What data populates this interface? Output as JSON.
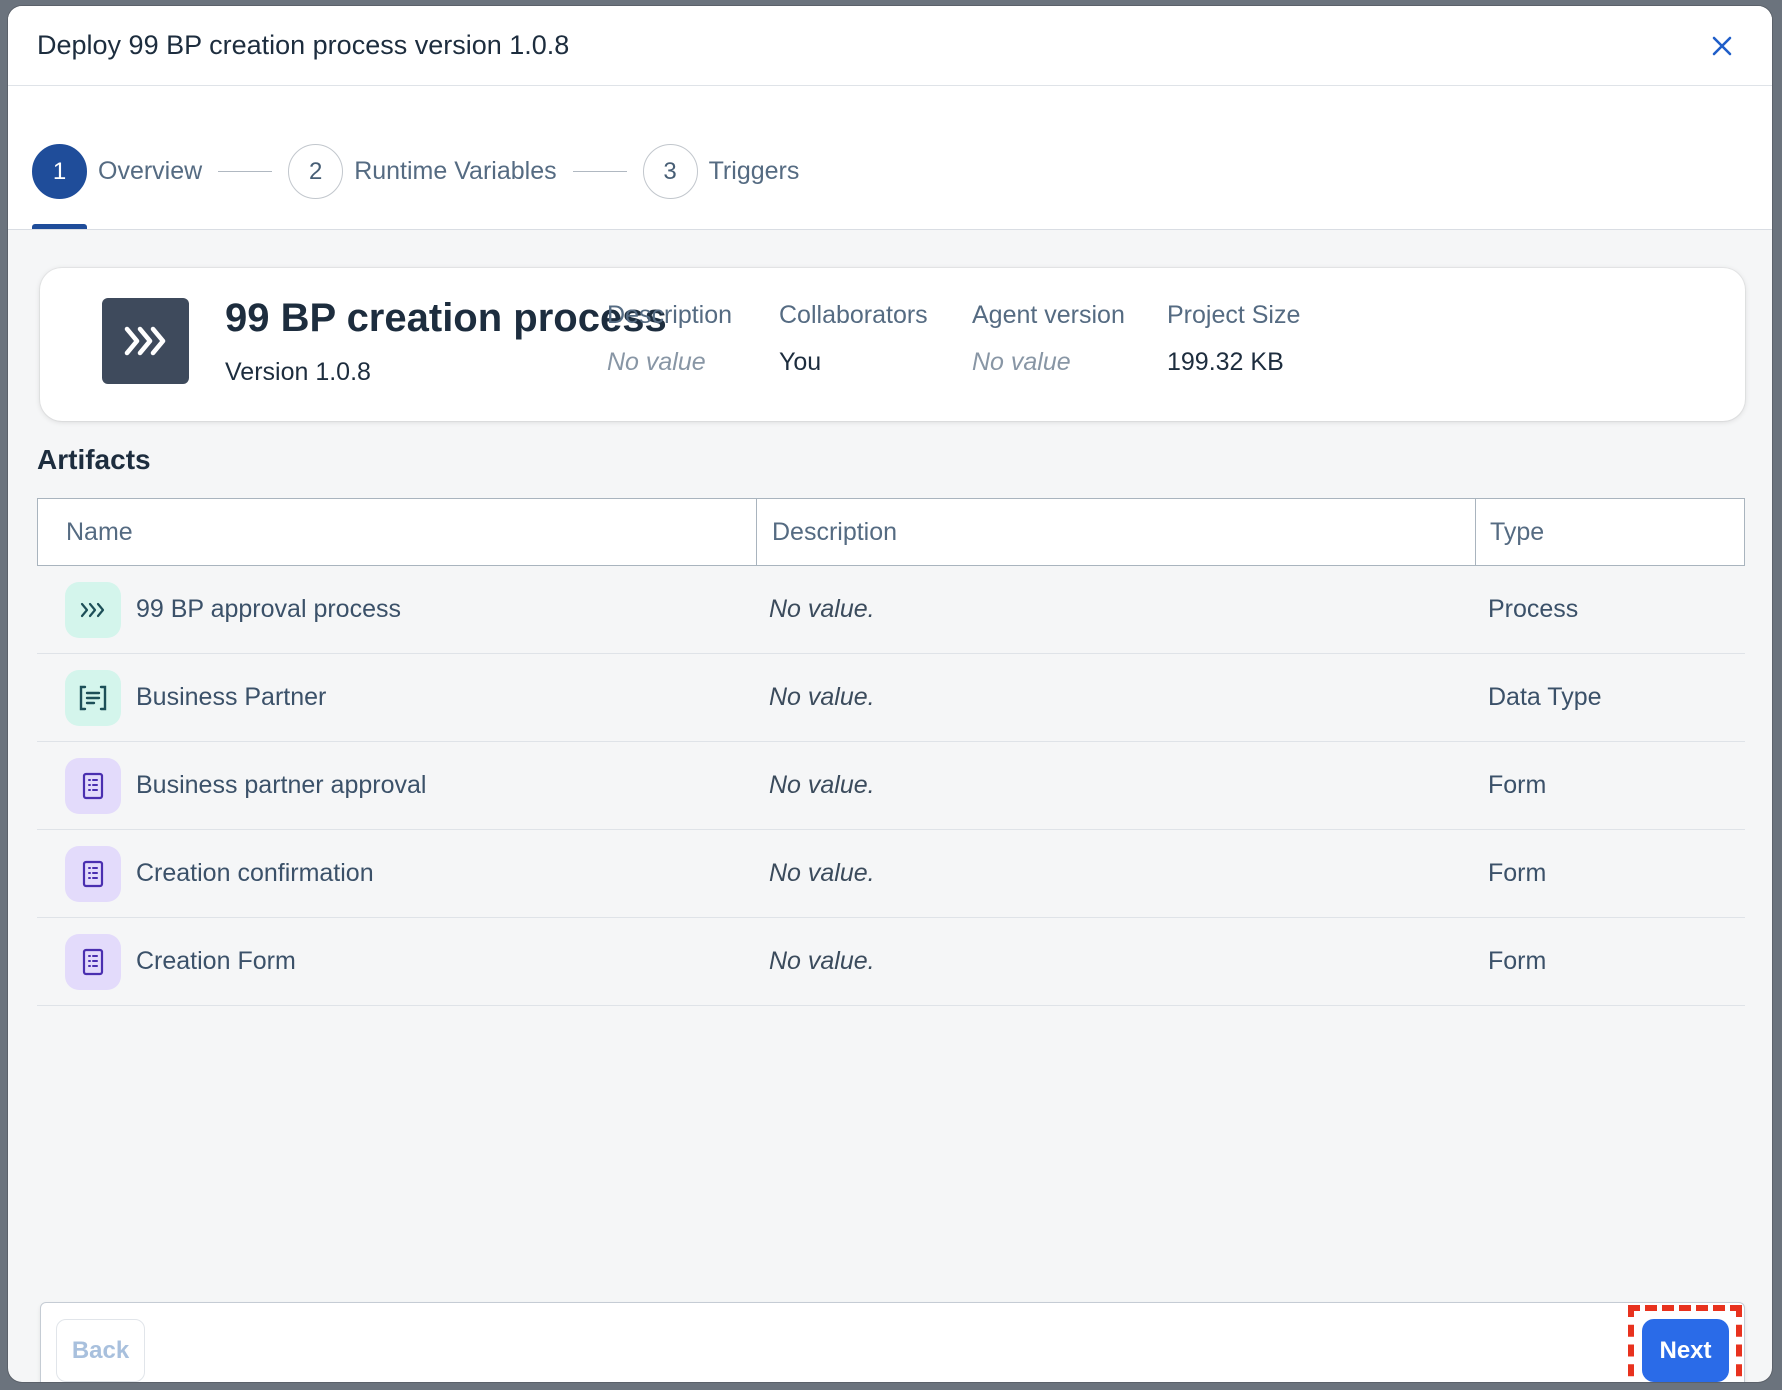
{
  "dialog": {
    "title": "Deploy 99 BP creation process version 1.0.8"
  },
  "wizard": {
    "steps": [
      {
        "number": "1",
        "label": "Overview",
        "active": true
      },
      {
        "number": "2",
        "label": "Runtime Variables",
        "active": false
      },
      {
        "number": "3",
        "label": "Triggers",
        "active": false
      }
    ]
  },
  "summary": {
    "name": "99 BP creation process",
    "version": "Version 1.0.8",
    "meta": [
      {
        "label": "Description",
        "value": "No value",
        "empty": true
      },
      {
        "label": "Collaborators",
        "value": "You",
        "empty": false
      },
      {
        "label": "Agent version",
        "value": "No value",
        "empty": true
      },
      {
        "label": "Project Size",
        "value": "199.32 KB",
        "empty": false
      }
    ]
  },
  "artifacts": {
    "title": "Artifacts",
    "columns": [
      "Name",
      "Description",
      "Type"
    ],
    "rows": [
      {
        "icon": "process-icon",
        "name": "99 BP approval process",
        "description": "No value.",
        "type": "Process"
      },
      {
        "icon": "data-type-icon",
        "name": "Business Partner",
        "description": "No value.",
        "type": "Data Type"
      },
      {
        "icon": "form-icon",
        "name": "Business partner approval",
        "description": "No value.",
        "type": "Form"
      },
      {
        "icon": "form-icon",
        "name": "Creation confirmation",
        "description": "No value.",
        "type": "Form"
      },
      {
        "icon": "form-icon",
        "name": "Creation Form",
        "description": "No value.",
        "type": "Form"
      }
    ]
  },
  "footer": {
    "back_label": "Back",
    "next_label": "Next"
  },
  "colors": {
    "primary": "#2a6be8",
    "active_step": "#1f4d9a",
    "highlight": "#e8321e"
  }
}
